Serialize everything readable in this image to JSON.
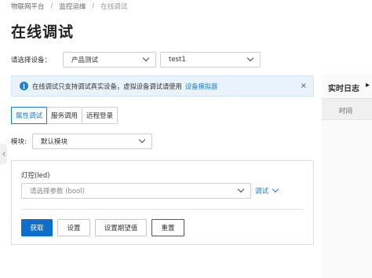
{
  "breadcrumb": {
    "items": [
      "物联网平台",
      "监控运维",
      "在线调试"
    ],
    "separator": "/"
  },
  "page_title": "在线调试",
  "device_select": {
    "label": "请选择设备：",
    "product_value": "产品测试",
    "device_value": "test1"
  },
  "notice": {
    "text": "在线调试只支持调试真实设备，虚拟设备调试请使用",
    "link": "设备模拟器",
    "close": "×"
  },
  "tabs": [
    {
      "label": "属性调试",
      "active": true
    },
    {
      "label": "服务调用",
      "active": false
    },
    {
      "label": "远程登录",
      "active": false
    }
  ],
  "module": {
    "label": "模块:",
    "value": "默认模块"
  },
  "property": {
    "label": "灯控(led)",
    "placeholder": "请选择参数 (bool)",
    "debug_label": "调试"
  },
  "buttons": {
    "get": "获取",
    "set": "设置",
    "set_expected": "设置期望值",
    "reset": "重置"
  },
  "log": {
    "title": "实时日志",
    "column_time": "时间"
  },
  "colors": {
    "accent": "#1a7ed6",
    "primary_button": "#0f6ec9",
    "notice_bg": "#e8f3fc"
  }
}
